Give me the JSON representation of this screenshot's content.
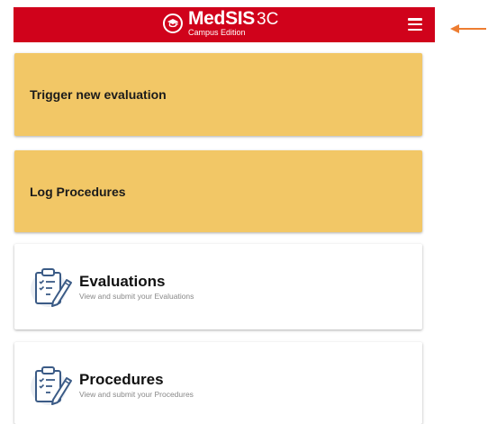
{
  "header": {
    "brand": "MedSIS",
    "version": "3C",
    "subtitle": "Campus Edition",
    "background_color": "#d0021b"
  },
  "annotation": {
    "color": "#ed7d31"
  },
  "actions": [
    {
      "label": "Trigger new evaluation",
      "color": "#f2c766"
    },
    {
      "label": "Log Procedures",
      "color": "#f2c766"
    }
  ],
  "modules": [
    {
      "title": "Evaluations",
      "description": "View and submit your Evaluations",
      "icon": "clipboard-checklist-icon"
    },
    {
      "title": "Procedures",
      "description": "View and submit your Procedures",
      "icon": "clipboard-checklist-icon"
    }
  ]
}
